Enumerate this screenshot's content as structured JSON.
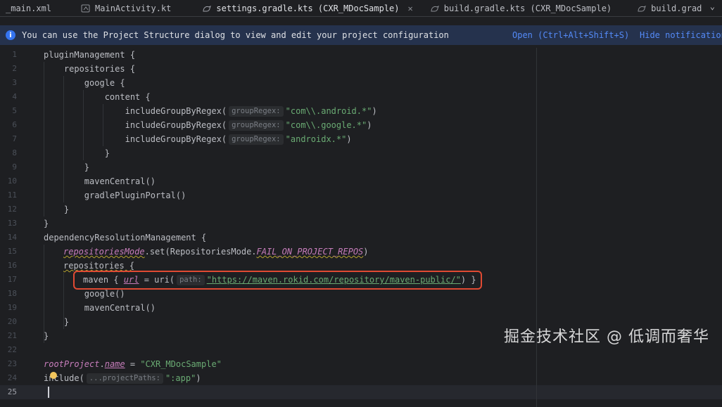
{
  "tabs": [
    {
      "label": "_main.xml",
      "icon": "xml-file-icon",
      "active": false
    },
    {
      "label": "MainActivity.kt",
      "icon": "kotlin-file-icon",
      "active": false
    },
    {
      "label": "settings.gradle.kts (CXR_MDocSample)",
      "icon": "gradle-file-icon",
      "active": true
    },
    {
      "label": "build.gradle.kts (CXR_MDocSample)",
      "icon": "gradle-file-icon",
      "active": false
    },
    {
      "label": "build.grad",
      "icon": "gradle-file-icon",
      "active": false
    }
  ],
  "tab_close": "✕",
  "tab_overflow": "⌄",
  "banner": {
    "message": "You can use the Project Structure dialog to view and edit your project configuration",
    "open_link": "Open (Ctrl+Alt+Shift+S)",
    "hide_link": "Hide notification"
  },
  "editor": {
    "line_numbers": [
      "1",
      "2",
      "3",
      "4",
      "5",
      "6",
      "7",
      "8",
      "9",
      "10",
      "11",
      "12",
      "13",
      "14",
      "15",
      "16",
      "17",
      "18",
      "19",
      "20",
      "21",
      "22",
      "23",
      "24",
      "25"
    ],
    "current_line": 25,
    "code": {
      "l1": "pluginManagement {",
      "l2": "    repositories {",
      "l3": "        google {",
      "l4": "            content {",
      "l5_fn": "                includeGroupByRegex(",
      "l5_hint": "groupRegex:",
      "l5_str": "\"com\\\\.android.*\"",
      "l5_end": ")",
      "l6_fn": "                includeGroupByRegex(",
      "l6_hint": "groupRegex:",
      "l6_str": "\"com\\\\.google.*\"",
      "l6_end": ")",
      "l7_fn": "                includeGroupByRegex(",
      "l7_hint": "groupRegex:",
      "l7_str": "\"androidx.*\"",
      "l7_end": ")",
      "l8": "            }",
      "l9": "        }",
      "l10": "        mavenCentral()",
      "l11": "        gradlePluginPortal()",
      "l12": "    }",
      "l13": "}",
      "l14": "dependencyResolutionManagement {",
      "l15_a": "repositoriesMode",
      "l15_b": ".set(RepositoriesMode.",
      "l15_c": "FAIL_ON_PROJECT_REPOS",
      "l15_d": ")",
      "l16": "repositories {",
      "l17_a": "maven { ",
      "l17_b": "url",
      "l17_c": " = uri(",
      "l17_hint": "path:",
      "l17_str": "\"https://maven.rokid.com/repository/maven-public/\"",
      "l17_end": ") }",
      "l18": "        google()",
      "l19": "        mavenCentral()",
      "l20": "    }",
      "l21": "}",
      "l22": "",
      "l23_a": "rootProject",
      "l23_b": ".",
      "l23_c": "name",
      "l23_d": " = ",
      "l23_str": "\"CXR_MDocSample\"",
      "l24_a": "include(",
      "l24_hint": "...projectPaths:",
      "l24_str": "\":app\"",
      "l24_end": ")"
    }
  },
  "watermark": "掘金技术社区 @ 低调而奢华",
  "colors": {
    "background": "#1e1f22",
    "string": "#6aab73",
    "field": "#c77dbb",
    "link": "#548af7",
    "annotation_box": "#e04a33"
  }
}
